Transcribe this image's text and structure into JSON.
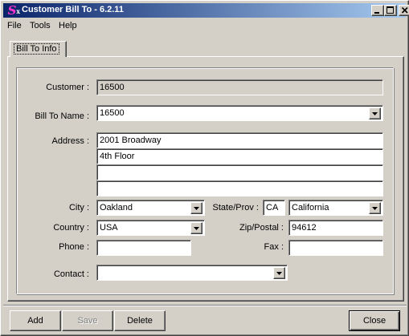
{
  "window": {
    "title": "Customer Bill To - 6.2.11",
    "icon": "sx-app-icon"
  },
  "menu": {
    "file": "File",
    "tools": "Tools",
    "help": "Help"
  },
  "tabs": [
    {
      "label": "Bill To Info",
      "active": true
    }
  ],
  "form": {
    "customer_label": "Customer :",
    "customer_value": "16500",
    "bill_to_name_label": "Bill To Name :",
    "bill_to_name_value": "16500",
    "address_label": "Address :",
    "address_lines": [
      "2001 Broadway",
      "4th Floor",
      "",
      ""
    ],
    "city_label": "City :",
    "city_value": "Oakland",
    "state_label": "State/Prov :",
    "state_code": "CA",
    "state_name": "California",
    "country_label": "Country :",
    "country_value": "USA",
    "zip_label": "Zip/Postal :",
    "zip_value": "94612",
    "phone_label": "Phone :",
    "phone_value": "",
    "fax_label": "Fax :",
    "fax_value": "",
    "contact_label": "Contact :",
    "contact_value": ""
  },
  "buttons": {
    "add": "Add",
    "save": "Save",
    "delete": "Delete",
    "close": "Close"
  },
  "colors": {
    "titlebar_start": "#0a246a",
    "titlebar_end": "#a6caf0",
    "face": "#d4d0c8"
  }
}
